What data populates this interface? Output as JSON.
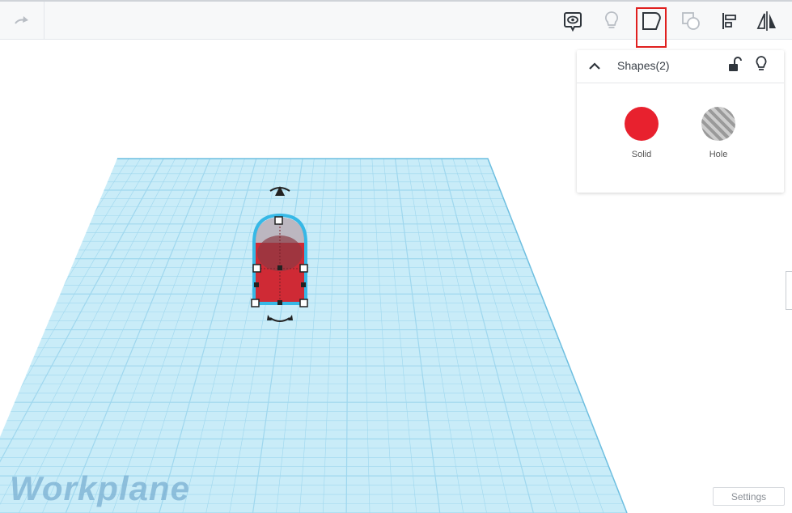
{
  "toolbar": {
    "buttons": [
      {
        "name": "redo",
        "icon": "redo-arrow-icon"
      },
      {
        "name": "notes",
        "icon": "eye-comment-icon"
      },
      {
        "name": "lightbulb",
        "icon": "lightbulb-icon"
      },
      {
        "name": "group",
        "icon": "shape-group-icon",
        "highlighted": true
      },
      {
        "name": "ungroup",
        "icon": "ungroup-icon"
      },
      {
        "name": "align",
        "icon": "align-icon"
      },
      {
        "name": "mirror",
        "icon": "mirror-icon"
      }
    ],
    "highlight_color": "#e0201f"
  },
  "inspector": {
    "title": "Shapes(2)",
    "solid_label": "Solid",
    "hole_label": "Hole",
    "solid_color": "#e8212e"
  },
  "workplane": {
    "label": "Workplane",
    "grid_color": "#9fd7ee",
    "object_color": "#cf2a35",
    "selection_color": "#36b8e6"
  },
  "settings_label": "Settings"
}
